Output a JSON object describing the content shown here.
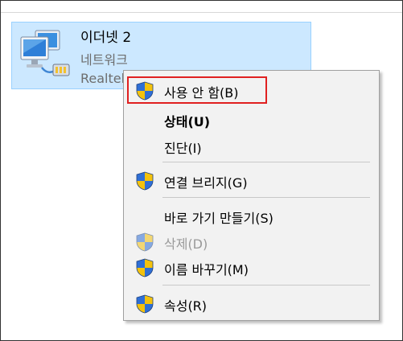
{
  "adapter": {
    "name": "이더넷 2",
    "subtitle": "네트워크",
    "device": "Realtek"
  },
  "menu": {
    "items": [
      {
        "label": "사용 안 함(B)",
        "icon": "uac-shield-icon"
      },
      {
        "label": "상태(U)"
      },
      {
        "label": "진단(I)"
      },
      {
        "label": "연결 브리지(G)",
        "icon": "uac-shield-icon"
      },
      {
        "label": "바로 가기 만들기(S)"
      },
      {
        "label": "삭제(D)",
        "icon": "uac-shield-icon"
      },
      {
        "label": "이름 바꾸기(M)",
        "icon": "uac-shield-icon"
      },
      {
        "label": "속성(R)",
        "icon": "uac-shield-icon"
      }
    ]
  },
  "colors": {
    "selection": "#cce8ff",
    "highlight_box": "#e02020",
    "menu_background": "#f2f2f2"
  }
}
